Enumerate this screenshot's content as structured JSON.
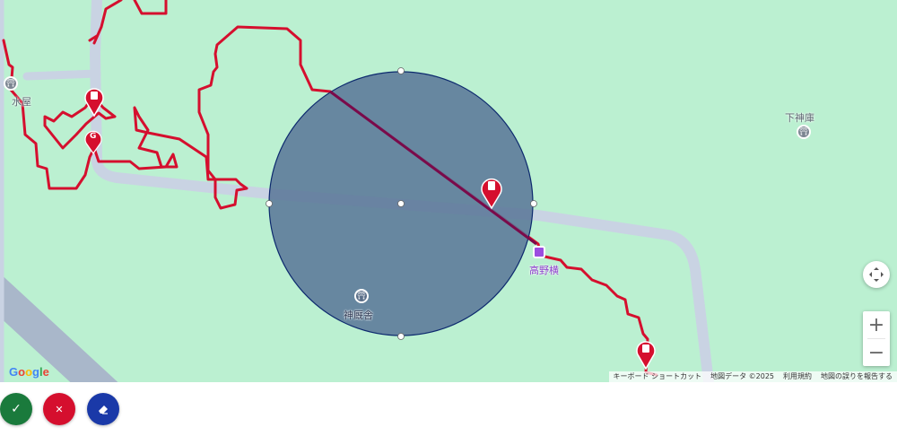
{
  "map": {
    "places": {
      "mizuya": "水屋",
      "shimo_shinko": "下神庫",
      "koya_yoko": "高野横",
      "shinkyusha": "神厩舎"
    },
    "marker_glyph_doc": "≡",
    "marker_glyph_g": "G",
    "poi_glyph": "⛩",
    "colors": {
      "land": "#bbf0d1",
      "road": "#c9d3e3",
      "route": "#d50f2e",
      "circle_fill": "#5b7799",
      "circle_stroke": "#0d2a6e",
      "radius_line": "#7a0a4a"
    }
  },
  "controls": {
    "pan_icon": "move-icon",
    "zoom_in": "+",
    "zoom_out": "−"
  },
  "google_logo": {
    "letters": [
      "G",
      "o",
      "o",
      "g",
      "l",
      "e"
    ],
    "colors": [
      "#4285f4",
      "#ea4335",
      "#fbbc05",
      "#4285f4",
      "#34a853",
      "#ea4335"
    ]
  },
  "attribution": {
    "shortcuts": "キーボード ショートカット",
    "map_data": "地図データ ©2025",
    "terms": "利用規約",
    "report": "地図の誤りを報告する"
  },
  "actions": {
    "confirm_icon": "✓",
    "cancel_icon": "✕",
    "erase_icon": "eraser-icon",
    "colors": {
      "confirm": "#1a7a3c",
      "cancel": "#d50f2e",
      "erase": "#1a39a8"
    }
  }
}
